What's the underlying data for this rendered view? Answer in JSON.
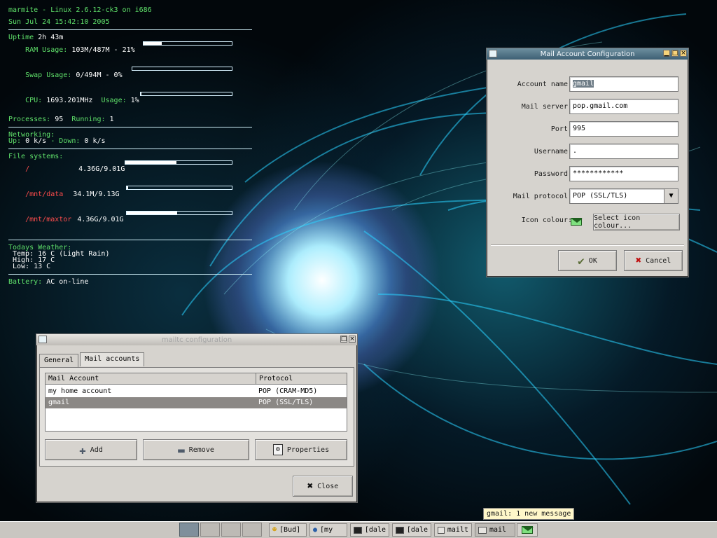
{
  "conky": {
    "host_line": "marmite - Linux 2.6.12-ck3 on i686",
    "date_line": "Sun Jul 24 15:42:10 2005",
    "uptime_label": "Uptime",
    "uptime_value": "2h 43m",
    "ram_label": "RAM Usage:",
    "ram_value": "103M/487M - 21%",
    "ram_bar": 0.21,
    "swap_label": "Swap Usage:",
    "swap_value": "0/494M - 0%",
    "swap_bar": 0.0,
    "cpu_label": "CPU:",
    "cpu_freq": "1693.201MHz",
    "cpu_usage_label": "Usage:",
    "cpu_usage_value": "1%",
    "cpu_bar": 0.01,
    "processes_label": "Processes:",
    "processes_value": "95",
    "running_label": "Running:",
    "running_value": "1",
    "networking_label": "Networking:",
    "up_label": "Up:",
    "up_value": "0 k/s",
    "down_label": "- Down:",
    "down_value": "0 k/s",
    "fs_label": "File systems:",
    "fs": [
      {
        "mount": "/",
        "value": "4.36G/9.01G",
        "bar": 0.48
      },
      {
        "mount": "/mnt/data",
        "value": "34.1M/9.13G",
        "bar": 0.01
      },
      {
        "mount": "/mnt/maxtor",
        "value": "4.36G/9.01G",
        "bar": 0.48
      }
    ],
    "weather_label": "Todays Weather:",
    "temp_line": "Temp: 16 C (Light Rain)",
    "high_line": "High: 17 C",
    "low_line": "Low: 13 C",
    "battery_label": "Battery:",
    "battery_value": "AC on-line"
  },
  "mail_account_window": {
    "title": "Mail Account Configuration",
    "fields": {
      "account_name_label": "Account name:",
      "account_name_value": "gmail",
      "mail_server_label": "Mail server:",
      "mail_server_value": "pop.gmail.com",
      "port_label": "Port:",
      "port_value": "995",
      "username_label": "Username:",
      "username_value": ".",
      "password_label": "Password:",
      "password_value": "************",
      "protocol_label": "Mail protocol:",
      "protocol_value": "POP (SSL/TLS)",
      "icon_colour_label": "Icon colour:",
      "select_icon_colour_button": "Select icon colour..."
    },
    "buttons": {
      "ok": "OK",
      "cancel": "Cancel"
    }
  },
  "mailtc_window": {
    "title": "mailtc configuration",
    "tabs": [
      "General",
      "Mail accounts"
    ],
    "table": {
      "headers": [
        "Mail Account",
        "Protocol"
      ],
      "rows": [
        {
          "account": "my home account",
          "protocol": "POP (CRAM-MD5)"
        },
        {
          "account": "gmail",
          "protocol": "POP (SSL/TLS)",
          "selected": true
        }
      ]
    },
    "buttons": {
      "add": "Add",
      "remove": "Remove",
      "properties": "Properties",
      "close": "Close"
    }
  },
  "taskbar": {
    "tasks": [
      "[Bud]",
      "[my",
      "[dale",
      "[dale",
      "mailt",
      "mail"
    ],
    "tooltip": "gmail: 1 new message"
  },
  "colors": {
    "conky_green": "#5fe06a",
    "conky_red": "#ff4c4c",
    "titlebar_active": "#4f7385"
  }
}
